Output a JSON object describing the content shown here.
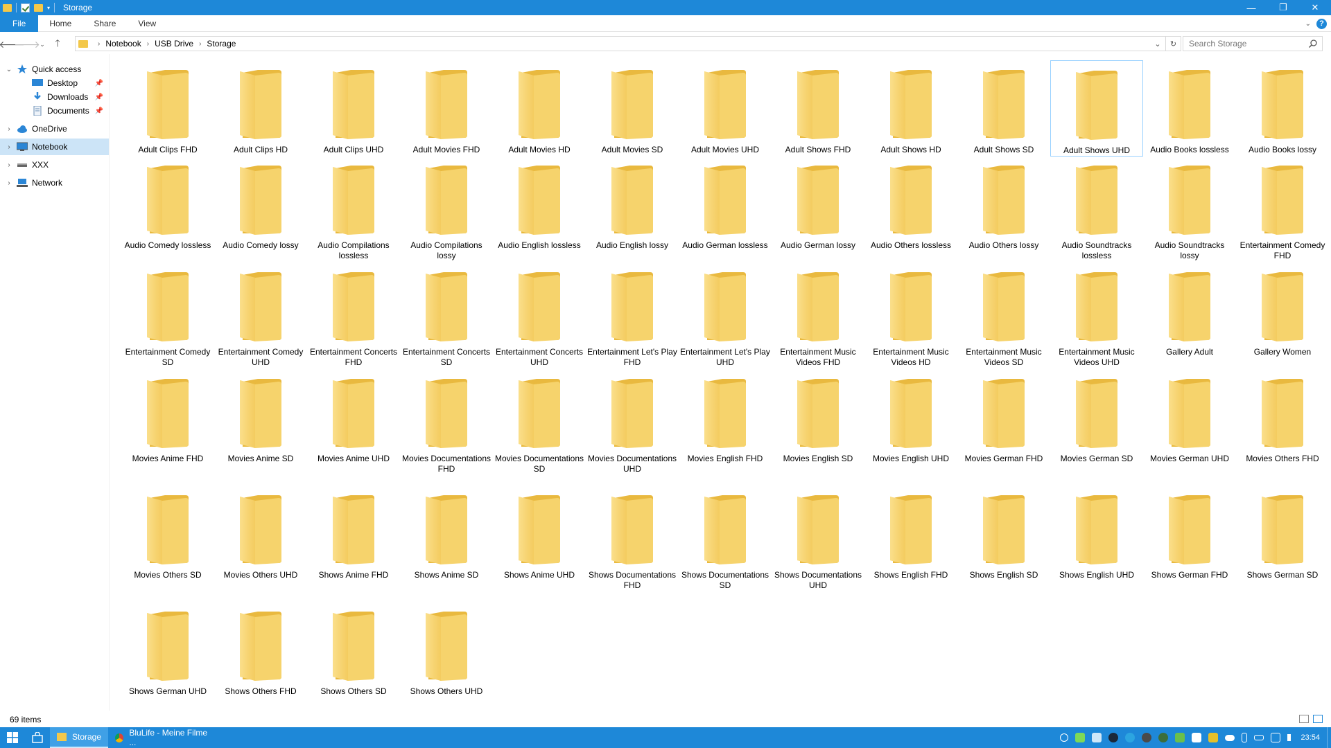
{
  "window": {
    "title": "Storage",
    "controls": {
      "minimize": "—",
      "maximize": "❐",
      "close": "✕"
    }
  },
  "ribbon": {
    "tabs": [
      {
        "label": "File"
      },
      {
        "label": "Home"
      },
      {
        "label": "Share"
      },
      {
        "label": "View"
      }
    ],
    "help": "?"
  },
  "address": {
    "breadcrumbs": [
      "Notebook",
      "USB Drive",
      "Storage"
    ],
    "search_placeholder": "Search Storage"
  },
  "navpane": {
    "items": [
      {
        "label": "Quick access",
        "icon": "star-icon",
        "expand": "expanded"
      },
      {
        "label": "Desktop",
        "icon": "desktop-icon",
        "pinned": true
      },
      {
        "label": "Downloads",
        "icon": "download-icon",
        "pinned": true
      },
      {
        "label": "Documents",
        "icon": "documents-icon",
        "pinned": true
      },
      {
        "label": "OneDrive",
        "icon": "cloud-icon",
        "expand": "collapsed"
      },
      {
        "label": "Notebook",
        "icon": "computer-icon",
        "expand": "collapsed",
        "selected": true
      },
      {
        "label": "XXX",
        "icon": "drive-icon",
        "expand": "collapsed"
      },
      {
        "label": "Network",
        "icon": "network-icon",
        "expand": "collapsed"
      }
    ]
  },
  "folders": [
    "Adult Clips FHD",
    "Adult Clips HD",
    "Adult Clips UHD",
    "Adult Movies FHD",
    "Adult Movies HD",
    "Adult Movies SD",
    "Adult Movies UHD",
    "Adult Shows FHD",
    "Adult Shows HD",
    "Adult Shows SD",
    "Adult Shows UHD",
    "Audio Books lossless",
    "Audio Books lossy",
    "Audio Comedy lossless",
    "Audio Comedy lossy",
    "Audio Compilations lossless",
    "Audio Compilations lossy",
    "Audio English lossless",
    "Audio English lossy",
    "Audio German lossless",
    "Audio German lossy",
    "Audio Others lossless",
    "Audio Others lossy",
    "Audio Soundtracks lossless",
    "Audio Soundtracks lossy",
    "Entertainment Comedy FHD",
    "Entertainment Comedy SD",
    "Entertainment Comedy UHD",
    "Entertainment Concerts FHD",
    "Entertainment Concerts SD",
    "Entertainment Concerts UHD",
    "Entertainment Let's Play FHD",
    "Entertainment Let's Play UHD",
    "Entertainment Music Videos FHD",
    "Entertainment Music Videos HD",
    "Entertainment Music Videos SD",
    "Entertainment Music Videos UHD",
    "Gallery Adult",
    "Gallery Women",
    "Movies Anime FHD",
    "Movies Anime SD",
    "Movies Anime UHD",
    "Movies Documentations FHD",
    "Movies Documentations SD",
    "Movies Documentations UHD",
    "Movies English FHD",
    "Movies English SD",
    "Movies English UHD",
    "Movies German FHD",
    "Movies German SD",
    "Movies German UHD",
    "Movies Others FHD",
    "Movies Others SD",
    "Movies Others UHD",
    "Shows Anime FHD",
    "Shows Anime SD",
    "Shows Anime UHD",
    "Shows Documentations FHD",
    "Shows Documentations SD",
    "Shows Documentations UHD",
    "Shows English FHD",
    "Shows English SD",
    "Shows English UHD",
    "Shows German FHD",
    "Shows German SD",
    "Shows German UHD",
    "Shows Others FHD",
    "Shows Others SD",
    "Shows Others UHD"
  ],
  "selected_folder": "Adult Shows UHD",
  "statusbar": {
    "item_count": "69 items"
  },
  "taskbar": {
    "apps": [
      {
        "label": "Storage",
        "icon": "folder-icon",
        "active": true
      },
      {
        "label": "BluLife - Meine Filme ...",
        "icon": "chrome-icon",
        "active": false
      }
    ],
    "clock": "23:54"
  },
  "colors": {
    "accent": "#1e88d8",
    "folder_front": "#f7d675",
    "folder_back": "#e9b93f",
    "selection": "#cce4f7"
  }
}
